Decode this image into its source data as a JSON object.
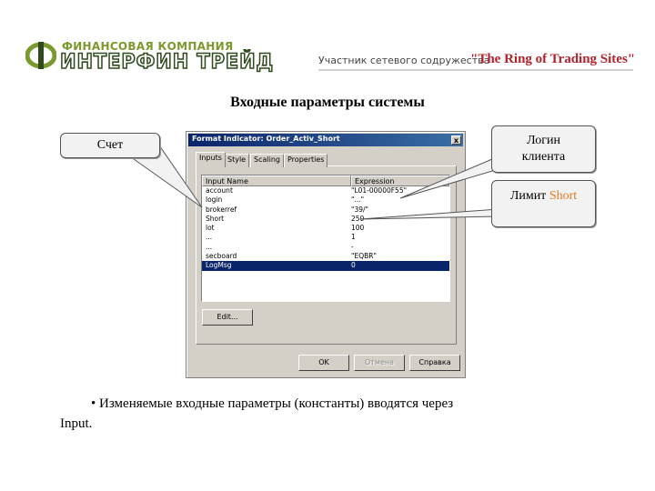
{
  "header": {
    "company_top": "ФИНАНСОВАЯ КОМПАНИЯ",
    "company_main": "ИНТЕРФИН ТРЕЙД",
    "partner_text": "Участник сетевого содружества",
    "ring_text": "\"The  Ring of Trading Sites\""
  },
  "slide": {
    "title": "Входные параметры системы",
    "bullet_line1": "•  Изменяемые входные параметры (константы) вводятся через",
    "bullet_line2": "Input."
  },
  "callouts": {
    "account": "Счет",
    "login_line1": "Логин",
    "login_line2": "клиента",
    "limit_prefix": "Лимит ",
    "limit_short": "Short"
  },
  "dialog": {
    "title": "Format Indicator: Order_Activ_Short",
    "close_label": "x",
    "tabs": [
      "Inputs",
      "Style",
      "Scaling",
      "Properties"
    ],
    "columns": [
      "Input Name",
      "Expression"
    ],
    "rows": [
      {
        "name": "account",
        "expr": "\"L01-00000F55\""
      },
      {
        "name": "login",
        "expr": "\"...\""
      },
      {
        "name": "brokerref",
        "expr": "\"39/\""
      },
      {
        "name": "Short",
        "expr": "250"
      },
      {
        "name": "lot",
        "expr": "100"
      },
      {
        "name": "...",
        "expr": "1"
      },
      {
        "name": "...",
        "expr": "-"
      },
      {
        "name": "secboard",
        "expr": "\"EQBR\""
      },
      {
        "name": "LogMsg",
        "expr": "0"
      }
    ],
    "selected_row": 8,
    "edit_button": "Edit...",
    "ok_button": "OK",
    "cancel_button": "Отмена",
    "help_button": "Справка"
  }
}
